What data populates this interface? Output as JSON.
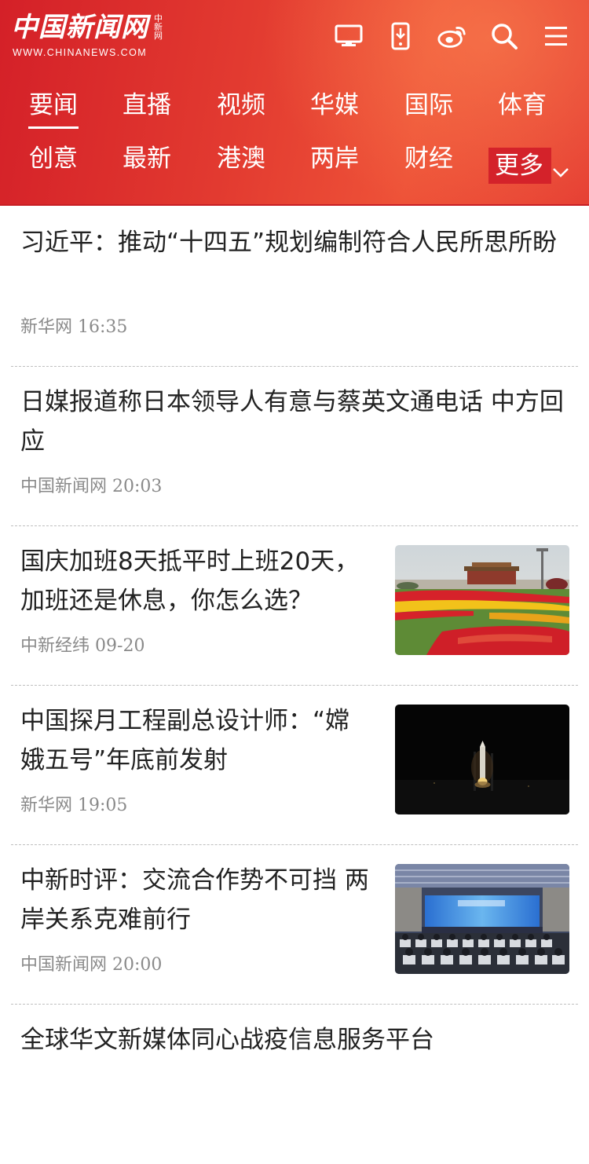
{
  "header": {
    "logo_main": "中国新闻网",
    "logo_side": "中新网",
    "logo_url": "WWW.CHINANEWS.COM",
    "icons": [
      "desktop-icon",
      "mobile-download-icon",
      "weibo-icon",
      "search-icon",
      "menu-icon"
    ]
  },
  "nav": {
    "row1": [
      "要闻",
      "直播",
      "视频",
      "华媒",
      "国际",
      "体育"
    ],
    "row2": [
      "创意",
      "最新",
      "港澳",
      "两岸",
      "财经"
    ],
    "more": "更多",
    "active": "要闻"
  },
  "news": [
    {
      "title": "习近平：推动“十四五”规划编制符合人民所思所盼",
      "source": "新华网",
      "time": "16:35",
      "image": ""
    },
    {
      "title": "日媒报道称日本领导人有意与蔡英文通电话 中方回应",
      "source": "中国新闻网",
      "time": "20:03",
      "image": ""
    },
    {
      "title": "国庆加班8天抵平时上班20天，加班还是休息，你怎么选？",
      "source": "中新经纬",
      "time": "09-20",
      "image": "tiananmen-square-flowers"
    },
    {
      "title": "中国探月工程副总设计师：“嫦娥五号”年底前发射",
      "source": "新华网",
      "time": "19:05",
      "image": "rocket-launch-night"
    },
    {
      "title": "中新时评：交流合作势不可挡 两岸关系克难前行",
      "source": "中国新闻网",
      "time": "20:00",
      "image": "conference-hall"
    },
    {
      "title": "全球华文新媒体同心战疫信息服务平台",
      "source": "",
      "time": "",
      "image": ""
    }
  ],
  "colors": {
    "brand_red": "#d42028",
    "title_text": "#222222",
    "meta_text": "#8a8a8a"
  }
}
